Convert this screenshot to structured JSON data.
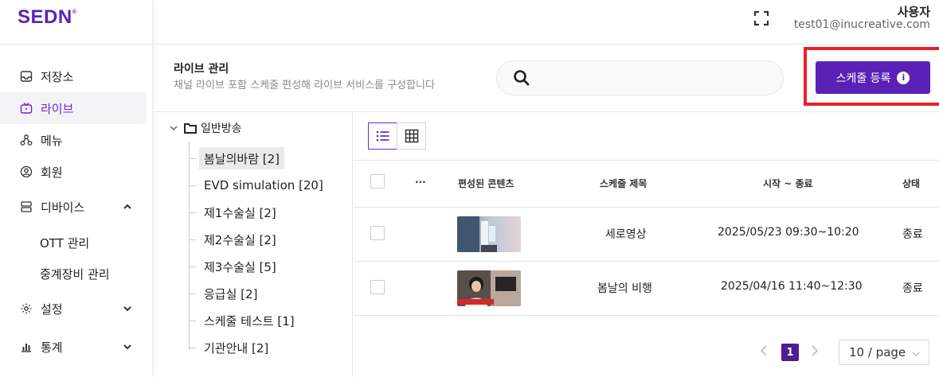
{
  "brand": {
    "logo": "SEDN",
    "logo_mark": "®"
  },
  "user": {
    "name": "사용자",
    "email": "test01@inucreative.com"
  },
  "sidebar": {
    "items": [
      {
        "label": "저장소",
        "icon": "inbox-icon"
      },
      {
        "label": "라이브",
        "icon": "tv-icon",
        "active": true
      },
      {
        "label": "메뉴",
        "icon": "menu-tree-icon"
      },
      {
        "label": "회원",
        "icon": "user-circle-icon"
      },
      {
        "label": "디바이스",
        "icon": "device-icon",
        "expanded": true
      },
      {
        "label": "설정",
        "icon": "gear-icon"
      },
      {
        "label": "통계",
        "icon": "bar-chart-icon"
      }
    ],
    "device_sub": [
      "OTT 관리",
      "중계장비 관리"
    ]
  },
  "page": {
    "title": "라이브 관리",
    "description": "채널 라이브 포함 스케줄 편성해 라이브 서비스를 구성합니다"
  },
  "search": {
    "placeholder": ""
  },
  "actions": {
    "schedule_register": "스케줄 등록",
    "info": "i"
  },
  "tree": {
    "root": "일반방송",
    "items": [
      {
        "label": "봄날의바람 [2]",
        "selected": true
      },
      {
        "label": "EVD simulation [20]"
      },
      {
        "label": "제1수술실 [2]"
      },
      {
        "label": "제2수술실 [2]"
      },
      {
        "label": "제3수술실 [5]"
      },
      {
        "label": "응급실 [2]"
      },
      {
        "label": "스케줄 테스트 [1]"
      },
      {
        "label": "기관안내 [2]"
      }
    ]
  },
  "table": {
    "headers": {
      "more": "...",
      "content": "편성된 콘텐츠",
      "title": "스케줄 제목",
      "period": "시작 ~ 종료",
      "status": "상태"
    },
    "rows": [
      {
        "title": "세로영상",
        "period": "2025/05/23 09:30~10:20",
        "status": "종료"
      },
      {
        "title": "봄날의 비행",
        "period": "2025/04/16 11:40~12:30",
        "status": "종료"
      }
    ]
  },
  "pagination": {
    "current": "1",
    "page_size": "10 / page"
  },
  "colors": {
    "brand": "#5b21b6",
    "highlight": "#e6212b"
  }
}
